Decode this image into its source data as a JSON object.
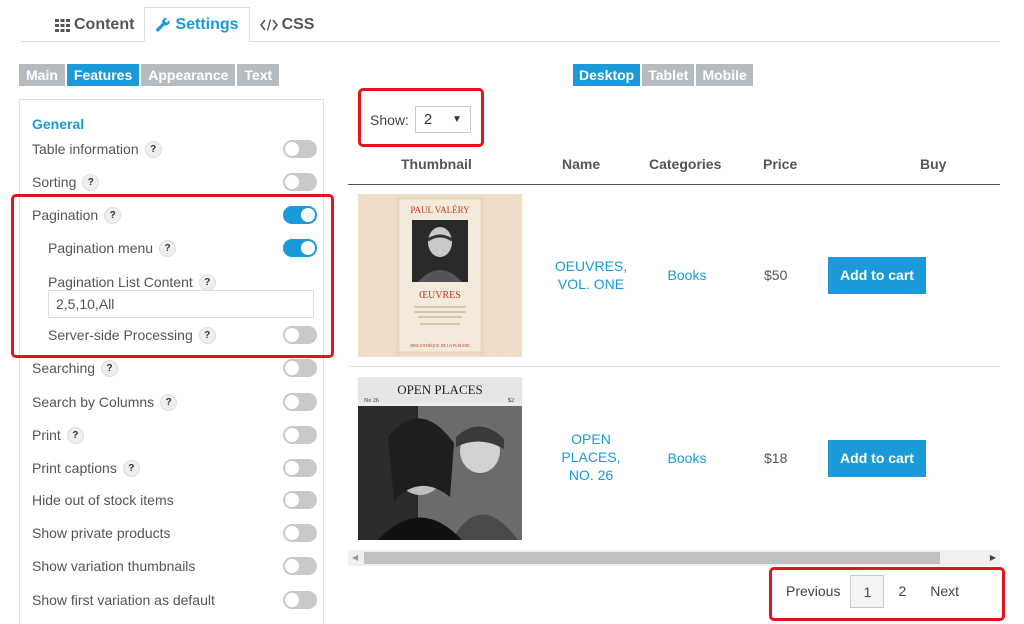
{
  "top_tabs": [
    {
      "label": "Content",
      "icon": "grid-icon"
    },
    {
      "label": "Settings",
      "icon": "wrench-icon"
    },
    {
      "label": "CSS",
      "icon": "code-icon"
    }
  ],
  "sub_tabs": [
    "Main",
    "Features",
    "Appearance",
    "Text"
  ],
  "panel": {
    "heading": "General",
    "help_glyph": "?",
    "settings": [
      {
        "label": "Table information",
        "on": false
      },
      {
        "label": "Sorting",
        "on": false
      },
      {
        "label": "Pagination",
        "on": true
      },
      {
        "label": "Pagination menu",
        "on": true
      },
      {
        "label": "Pagination List Content"
      },
      {
        "label": "Server-side Processing",
        "on": false
      },
      {
        "label": "Searching",
        "on": false
      },
      {
        "label": "Search by Columns",
        "on": false
      },
      {
        "label": "Print",
        "on": false
      },
      {
        "label": "Print captions",
        "on": false
      },
      {
        "label": "Hide out of stock items",
        "on": false
      },
      {
        "label": "Show private products",
        "on": false
      },
      {
        "label": "Show variation thumbnails",
        "on": false
      },
      {
        "label": "Show first variation as default",
        "on": false
      }
    ],
    "pagination_list_value": "2,5,10,All"
  },
  "device_tabs": [
    "Desktop",
    "Tablet",
    "Mobile"
  ],
  "show": {
    "label": "Show:",
    "value": "2",
    "caret": "▼"
  },
  "table": {
    "headers": [
      "Thumbnail",
      "Name",
      "Categories",
      "Price",
      "Buy"
    ],
    "rows": [
      {
        "name_lines": [
          "OEUVRES,",
          "VOL. ONE"
        ],
        "category": "Books",
        "price": "$50",
        "buy_label": "Add to cart",
        "cover": {
          "author": "PAUL VALÉRY",
          "title": "ŒUVRES",
          "footer": "BIBLIOTHÈQUE DE LA PLÉIADE"
        }
      },
      {
        "name_lines": [
          "OPEN",
          "PLACES,",
          "NO. 26"
        ],
        "category": "Books",
        "price": "$18",
        "buy_label": "Add to cart",
        "cover": {
          "title": "OPEN PLACES",
          "issue": "No 26",
          "price": "$2"
        }
      }
    ]
  },
  "pagination": {
    "previous": "Previous",
    "pages": [
      "1",
      "2"
    ],
    "next": "Next"
  },
  "colors": {
    "accent": "#1a9ad8",
    "highlight": "#e3141a",
    "inactive_tab": "#b4bcc2"
  }
}
